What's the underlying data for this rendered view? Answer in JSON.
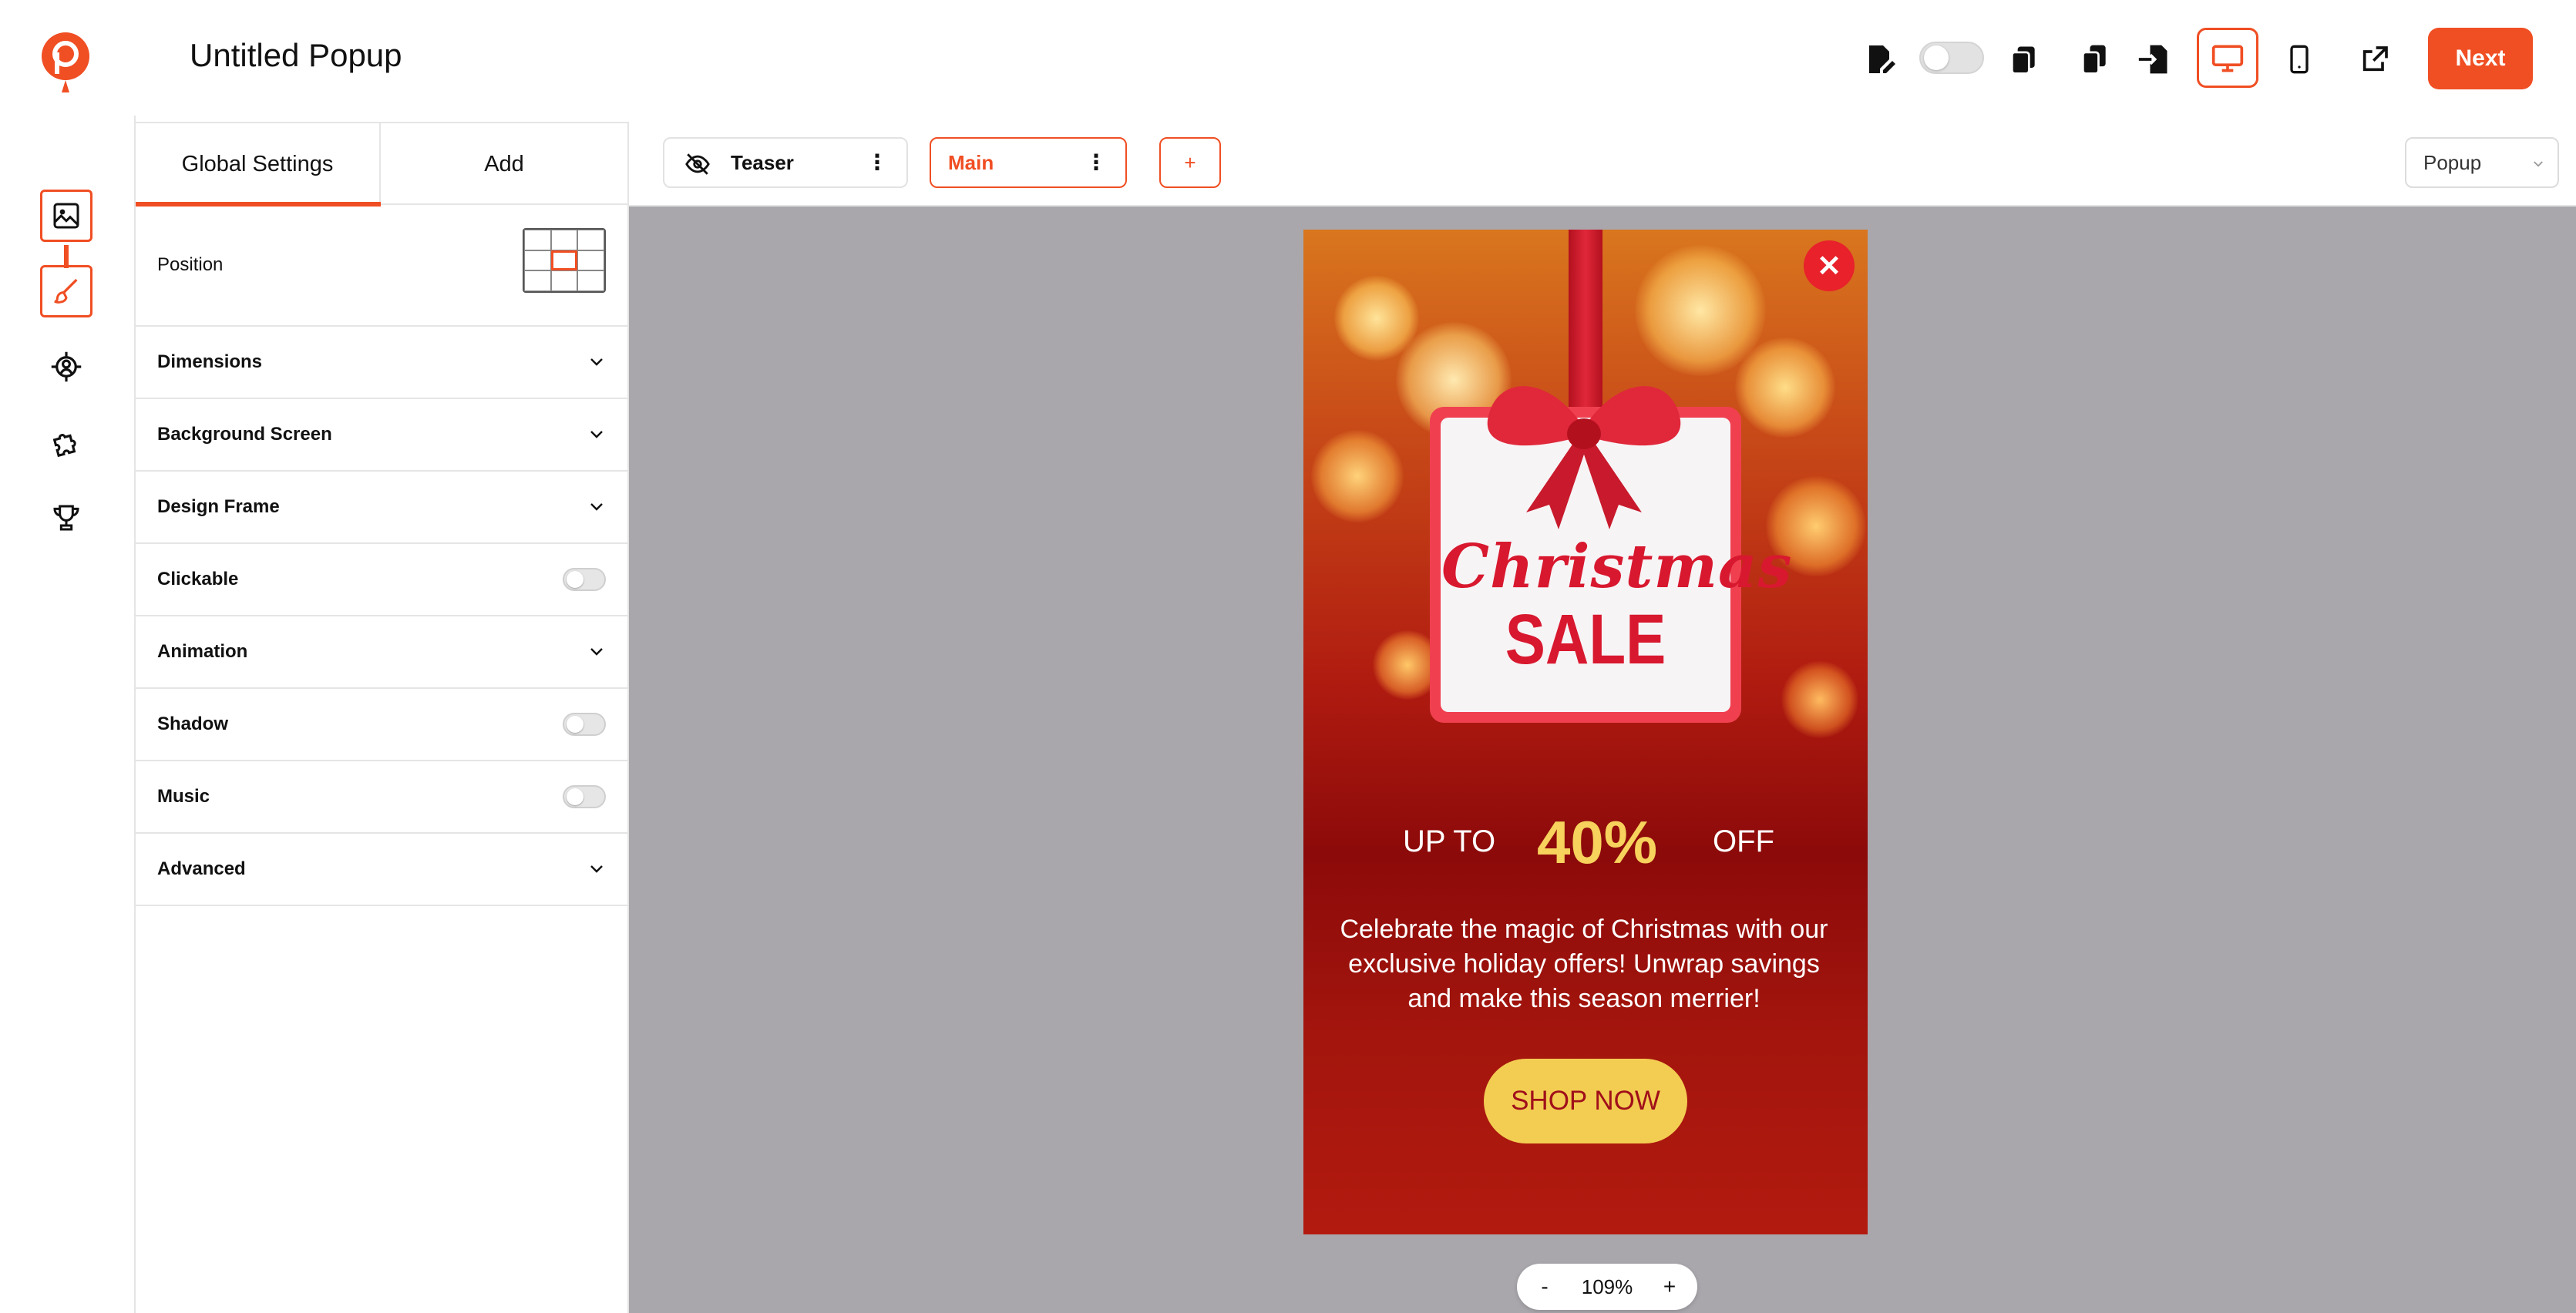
{
  "app": {
    "title": "Untitled Popup",
    "accent_color": "#f04e23"
  },
  "topbar": {
    "icons": [
      "edit-doc-icon",
      "toggle",
      "copy-icon",
      "duplicate-icon",
      "import-icon",
      "desktop-icon",
      "mobile-icon",
      "external-link-icon"
    ],
    "next_label": "Next"
  },
  "rail": {
    "items": [
      "image-icon",
      "brush-icon",
      "target-icon",
      "puzzle-icon",
      "trophy-icon"
    ]
  },
  "panel": {
    "tabs": [
      {
        "label": "Global Settings",
        "active": true
      },
      {
        "label": "Add",
        "active": false
      }
    ],
    "position_label": "Position",
    "rows": [
      {
        "label": "Dimensions",
        "control": "chevron"
      },
      {
        "label": "Background Screen",
        "control": "chevron"
      },
      {
        "label": "Design Frame",
        "control": "chevron"
      },
      {
        "label": "Clickable",
        "control": "toggle"
      },
      {
        "label": "Animation",
        "control": "chevron"
      },
      {
        "label": "Shadow",
        "control": "toggle"
      },
      {
        "label": "Music",
        "control": "toggle"
      },
      {
        "label": "Advanced",
        "control": "chevron"
      }
    ]
  },
  "screens": {
    "teaser_label": "Teaser",
    "main_label": "Main",
    "add_label": "+",
    "type_select": "Popup"
  },
  "popup": {
    "heading_script": "Christmas",
    "heading_sale": "SALE",
    "up_to": "UP TO",
    "percent": "40%",
    "off": "OFF",
    "body": "Celebrate the magic of Christmas with our exclusive holiday offers! Unwrap savings and make this season merrier!",
    "cta": "SHOP NOW",
    "close": "✕"
  },
  "zoom": {
    "minus": "-",
    "level": "109%",
    "plus": "+"
  }
}
